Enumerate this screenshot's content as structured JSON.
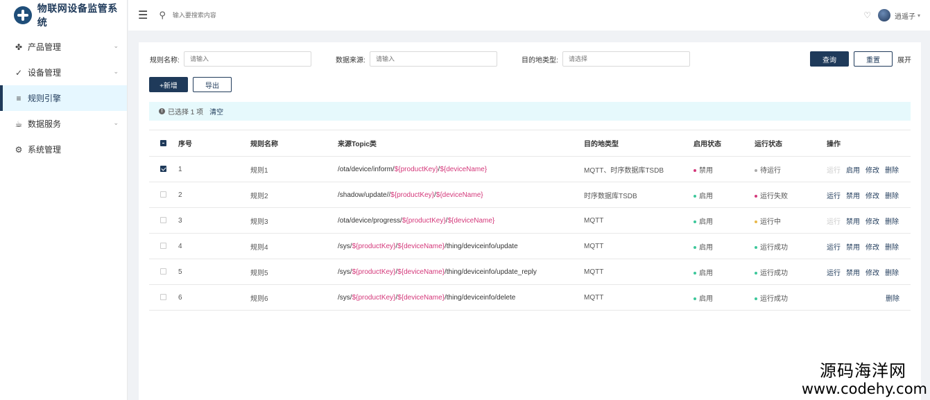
{
  "app": {
    "title": "物联网设备监管系统"
  },
  "colors": {
    "brand": "#1f3a5a",
    "var_text": "#d4387a",
    "active_menu_bg": "#e6f7ff",
    "alert_bg": "#e6f9fc"
  },
  "sidebar": {
    "items": [
      {
        "label": "产品管理",
        "icon": "puzzle-icon",
        "has_children": true,
        "active": false
      },
      {
        "label": "设备管理",
        "icon": "wrench-icon",
        "has_children": true,
        "active": false
      },
      {
        "label": "规则引擎",
        "icon": "rss-icon",
        "has_children": false,
        "active": true
      },
      {
        "label": "数据服务",
        "icon": "cup-icon",
        "has_children": true,
        "active": false
      },
      {
        "label": "系统管理",
        "icon": "gear-icon",
        "has_children": false,
        "active": false
      }
    ]
  },
  "header": {
    "search_placeholder": "输入要搜索内容",
    "username": "逍遥子"
  },
  "filters": {
    "rule_name_label": "规则名称:",
    "rule_name_placeholder": "请输入",
    "source_label": "数据来源:",
    "source_placeholder": "请输入",
    "dest_label": "目的地类型:",
    "dest_placeholder": "请选择",
    "query_label": "查询",
    "reset_label": "重置",
    "expand_label": "展开"
  },
  "actions": {
    "add_label": "+新增",
    "export_label": "导出"
  },
  "selection": {
    "text": "已选择 1 项",
    "clear_label": "清空"
  },
  "table": {
    "columns": [
      "序号",
      "规则名称",
      "来源Topic类",
      "目的地类型",
      "启用状态",
      "运行状态",
      "操作"
    ],
    "rows": [
      {
        "checked": true,
        "no": "1",
        "name": "规则1",
        "topic": [
          "/ota/device/inform/",
          "${productKey}",
          "/",
          "${deviceName}",
          ""
        ],
        "dest": "MQTT、时序数据库TSDB",
        "enable": "禁用",
        "enable_color": "#d4387a",
        "run": "待运行",
        "run_color": "#aaaaaa",
        "ops": [
          [
            "运行",
            true
          ],
          [
            "启用",
            false
          ],
          [
            "修改",
            false
          ],
          [
            "删除",
            false
          ]
        ]
      },
      {
        "checked": false,
        "no": "2",
        "name": "规则2",
        "topic": [
          "/shadow/update//",
          "${productKey}",
          "/",
          "${deviceName}",
          ""
        ],
        "dest": "时序数据库TSDB",
        "enable": "启用",
        "enable_color": "#3cc79a",
        "run": "运行失败",
        "run_color": "#d4387a",
        "ops": [
          [
            "运行",
            false
          ],
          [
            "禁用",
            false
          ],
          [
            "修改",
            false
          ],
          [
            "删除",
            false
          ]
        ]
      },
      {
        "checked": false,
        "no": "3",
        "name": "规则3",
        "topic": [
          "/ota/device/progress/",
          "${productKey}",
          "/",
          "${deviceName}",
          ""
        ],
        "dest": "MQTT",
        "enable": "启用",
        "enable_color": "#3cc79a",
        "run": "运行中",
        "run_color": "#e8b84a",
        "ops": [
          [
            "运行",
            true
          ],
          [
            "禁用",
            false
          ],
          [
            "修改",
            false
          ],
          [
            "删除",
            false
          ]
        ]
      },
      {
        "checked": false,
        "no": "4",
        "name": "规则4",
        "topic": [
          "/sys/",
          "${productKey}",
          "/",
          "${deviceName}",
          "/thing/deviceinfo/update"
        ],
        "dest": "MQTT",
        "enable": "启用",
        "enable_color": "#3cc79a",
        "run": "运行成功",
        "run_color": "#3cc79a",
        "ops": [
          [
            "运行",
            false
          ],
          [
            "禁用",
            false
          ],
          [
            "修改",
            false
          ],
          [
            "删除",
            false
          ]
        ]
      },
      {
        "checked": false,
        "no": "5",
        "name": "规则5",
        "topic": [
          "/sys/",
          "${productKey}",
          "/",
          "${deviceName}",
          "/thing/deviceinfo/update_reply"
        ],
        "dest": "MQTT",
        "enable": "启用",
        "enable_color": "#3cc79a",
        "run": "运行成功",
        "run_color": "#3cc79a",
        "ops": [
          [
            "运行",
            false
          ],
          [
            "禁用",
            false
          ],
          [
            "修改",
            false
          ],
          [
            "删除",
            false
          ]
        ]
      },
      {
        "checked": false,
        "no": "6",
        "name": "规则6",
        "topic": [
          "/sys/",
          "${productKey}",
          "/",
          "${deviceName}",
          "/thing/deviceinfo/delete"
        ],
        "dest": "MQTT",
        "enable": "启用",
        "enable_color": "#3cc79a",
        "run": "运行成功",
        "run_color": "#3cc79a",
        "ops": [
          [
            "删除",
            false
          ]
        ]
      }
    ]
  },
  "watermark": {
    "cn": "源码海洋网",
    "url": "www.codehy.com"
  }
}
